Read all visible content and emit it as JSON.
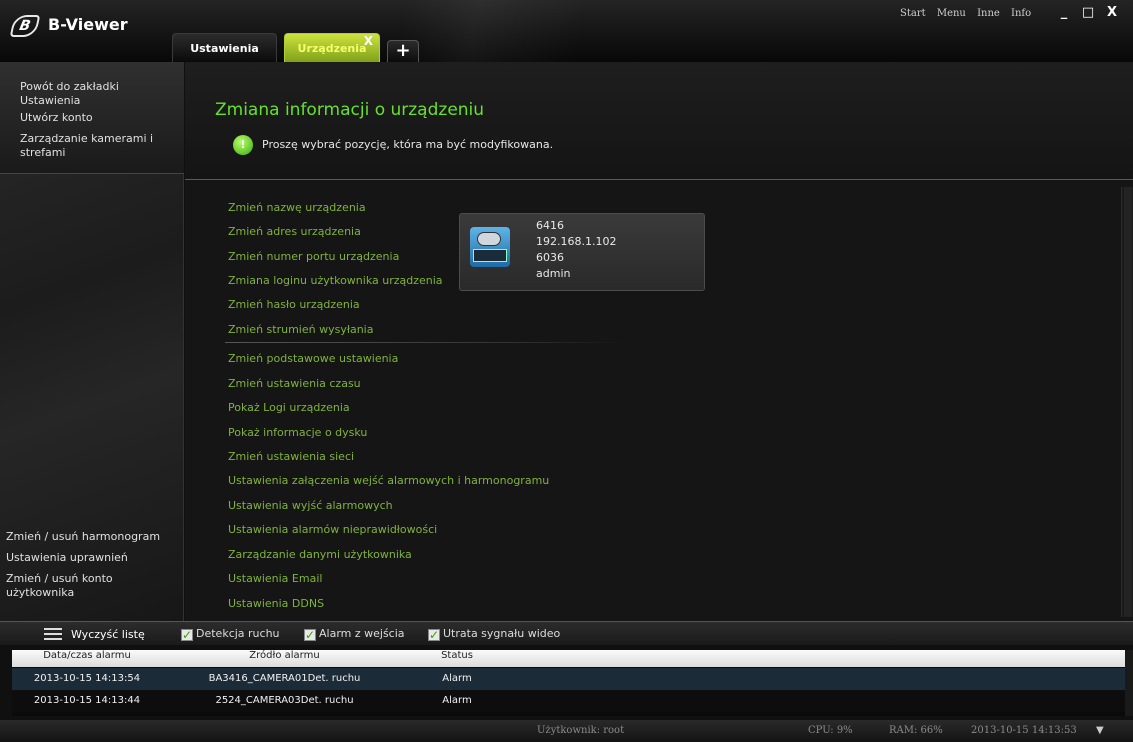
{
  "app": {
    "title": "B-Viewer",
    "logo_letter": "B"
  },
  "tabs": [
    {
      "label": "Ustawienia"
    },
    {
      "label": "Urządzenia",
      "close": "X"
    }
  ],
  "tab_add": "+",
  "top_menu": [
    "Start",
    "Menu",
    "Inne",
    "Info"
  ],
  "window_controls": {
    "minimize": "_",
    "maximize": "□",
    "close": "X"
  },
  "sidebar": {
    "top": [
      "Powót do zakładki Ustawienia",
      "Utwórz konto",
      "Zarządzanie kamerami i strefami"
    ],
    "bottom": [
      "Zmień / usuń harmonogram",
      "Ustawienia uprawnień",
      "Zmień / usuń konto użytkownika"
    ]
  },
  "main": {
    "title": "Zmiana informacji o urządzeniu",
    "hint": "Proszę wybrać pozycję, która ma być modyfikowana.",
    "hint_icon": "!",
    "options": [
      "Zmień nazwę urządzenia",
      "Zmień adres urządzenia",
      "Zmień numer portu urządzenia",
      "Zmiana loginu użytkownika urządzenia",
      "Zmień hasło urządzenia",
      "Zmień strumień wysyłania",
      "Zmień podstawowe ustawienia",
      "Zmień ustawienia czasu",
      "Pokaż Logi urządzenia",
      "Pokaż informacje o dysku",
      "Zmień ustawienia sieci",
      "Ustawienia załączenia wejść alarmowych i harmonogramu",
      "Ustawienia wyjść alarmowych",
      "Ustawienia alarmów nieprawidłowości",
      "Zarządzanie danymi użytkownika",
      "Ustawienia Email",
      "Ustawienia DDNS"
    ],
    "device": {
      "name": "6416",
      "ip": "192.168.1.102",
      "port": "6036",
      "user": "admin"
    }
  },
  "alarm_panel": {
    "clear_label": "Wyczyść listę",
    "filters": [
      "Detekcja ruchu",
      "Alarm z wejścia",
      "Utrata sygnału wideo"
    ],
    "check_mark": "✓",
    "columns": [
      "Data/czas alarmu",
      "Źródło alarmu",
      "Status"
    ],
    "rows": [
      {
        "time": "2013-10-15 14:13:54",
        "source": "BA3416_CAMERA01Det. ruchu",
        "status": "Alarm"
      },
      {
        "time": "2013-10-15 14:13:44",
        "source": "2524_CAMERA03Det. ruchu",
        "status": "Alarm"
      }
    ]
  },
  "status_bar": {
    "user": "Użytkownik: root",
    "cpu": "CPU: 9%",
    "ram": "RAM: 66%",
    "datetime": "2013-10-15 14:13:53",
    "dropdown_icon": "▼"
  }
}
